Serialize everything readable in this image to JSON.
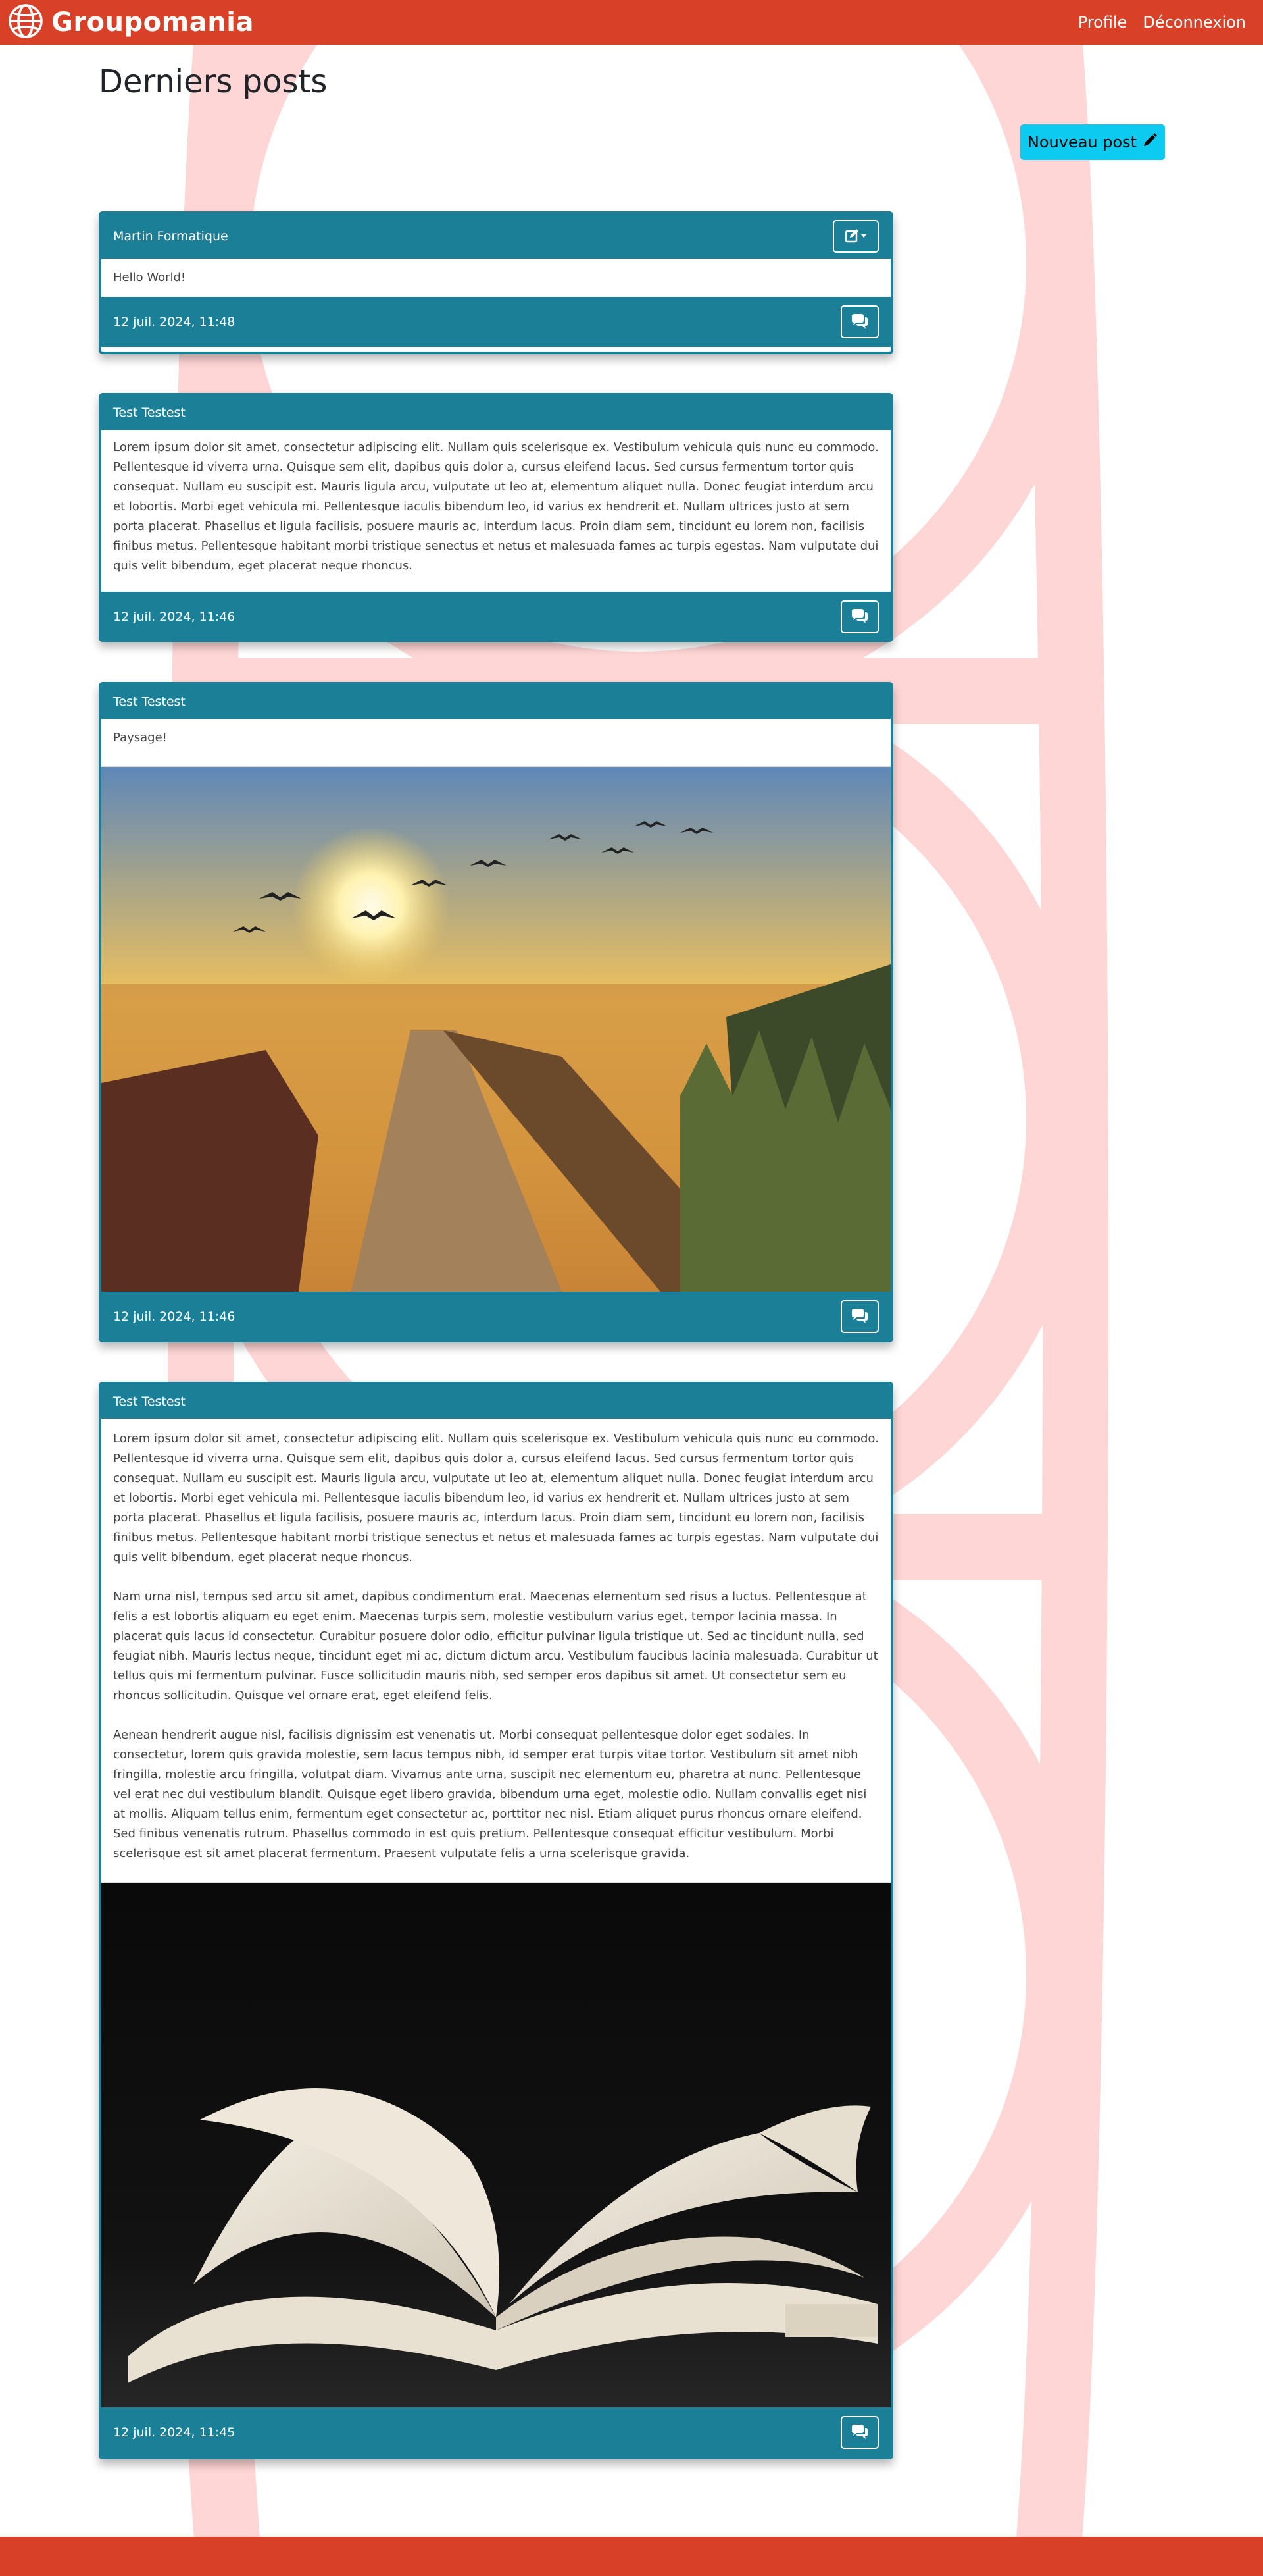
{
  "app": {
    "title": "Groupomania"
  },
  "nav": {
    "profile_label": "Profile",
    "logout_label": "Déconnexion"
  },
  "page": {
    "title": "Derniers posts",
    "new_post_label": "Nouveau post"
  },
  "posts": [
    {
      "author": "Martin Formatique",
      "paragraphs": [
        "Hello World!"
      ],
      "date": "12 juil. 2024, 11:48",
      "has_edit_menu": true
    },
    {
      "author": "Test Testest",
      "paragraphs": [
        "Lorem ipsum dolor sit amet, consectetur adipiscing elit. Nullam quis scelerisque ex. Vestibulum vehicula quis nunc eu commodo. Pellentesque id viverra urna. Quisque sem elit, dapibus quis dolor a, cursus eleifend lacus. Sed cursus fermentum tortor quis consequat. Nullam eu suscipit est. Mauris ligula arcu, vulputate ut leo at, elementum aliquet nulla. Donec feugiat interdum arcu et lobortis. Morbi eget vehicula mi. Pellentesque iaculis bibendum leo, id varius ex hendrerit et. Nullam ultrices justo at sem porta placerat. Phasellus et ligula facilisis, posuere mauris ac, interdum lacus. Proin diam sem, tincidunt eu lorem non, facilisis finibus metus. Pellentesque habitant morbi tristique senectus et netus et malesuada fames ac turpis egestas. Nam vulputate dui quis velit bibendum, eget placerat neque rhoncus."
      ],
      "date": "12 juil. 2024, 11:46"
    },
    {
      "author": "Test Testest",
      "paragraphs": [
        "Paysage!"
      ],
      "date": "12 juil. 2024, 11:46",
      "image": "sunset-pier-photo"
    },
    {
      "author": "Test Testest",
      "paragraphs": [
        "Lorem ipsum dolor sit amet, consectetur adipiscing elit. Nullam quis scelerisque ex. Vestibulum vehicula quis nunc eu commodo. Pellentesque id viverra urna. Quisque sem elit, dapibus quis dolor a, cursus eleifend lacus. Sed cursus fermentum tortor quis consequat. Nullam eu suscipit est. Mauris ligula arcu, vulputate ut leo at, elementum aliquet nulla. Donec feugiat interdum arcu et lobortis. Morbi eget vehicula mi. Pellentesque iaculis bibendum leo, id varius ex hendrerit et. Nullam ultrices justo at sem porta placerat. Phasellus et ligula facilisis, posuere mauris ac, interdum lacus. Proin diam sem, tincidunt eu lorem non, facilisis finibus metus. Pellentesque habitant morbi tristique senectus et netus et malesuada fames ac turpis egestas. Nam vulputate dui quis velit bibendum, eget placerat neque rhoncus.",
        "Nam urna nisl, tempus sed arcu sit amet, dapibus condimentum erat. Maecenas elementum sed risus a luctus. Pellentesque at felis a est lobortis aliquam eu eget enim. Maecenas turpis sem, molestie vestibulum varius eget, tempor lacinia massa. In placerat quis lacus id consectetur. Curabitur posuere dolor odio, efficitur pulvinar ligula tristique ut. Sed ac tincidunt nulla, sed feugiat nibh. Mauris lectus neque, tincidunt eget mi ac, dictum dictum arcu. Vestibulum faucibus lacinia malesuada. Curabitur ut tellus quis mi fermentum pulvinar. Fusce sollicitudin mauris nibh, sed semper eros dapibus sit amet. Ut consectetur sem eu rhoncus sollicitudin. Quisque vel ornare erat, eget eleifend felis.",
        "Aenean hendrerit augue nisl, facilisis dignissim est venenatis ut. Morbi consequat pellentesque dolor eget sodales. In consectetur, lorem quis gravida molestie, sem lacus tempus nibh, id semper erat turpis vitae tortor. Vestibulum sit amet nibh fringilla, molestie arcu fringilla, volutpat diam. Vivamus ante urna, suscipit nec elementum eu, pharetra at nunc. Pellentesque vel erat nec dui vestibulum blandit. Quisque eget libero gravida, bibendum urna eget, molestie odio. Nullam convallis eget nisi at mollis. Aliquam tellus enim, fermentum eget consectetur ac, porttitor nec nisl. Etiam aliquet purus rhoncus ornare eleifend. Sed finibus venenatis rutrum. Phasellus commodo in est quis pretium. Pellentesque consequat efficitur vestibulum. Morbi scelerisque est sit amet placerat fermentum. Praesent vulputate felis a urna scelerisque gravida."
      ],
      "date": "12 juil. 2024, 11:45",
      "image": "open-book-photo"
    }
  ],
  "icons": {
    "brand": "globe-icon",
    "new_post": "pencil-icon",
    "edit_menu": "edit-icon",
    "comments": "comments-icon"
  },
  "colors": {
    "primary": "#d84127",
    "card": "#1b7f98",
    "button": "#0dcaf0",
    "background_art": "#ffd6d6"
  }
}
